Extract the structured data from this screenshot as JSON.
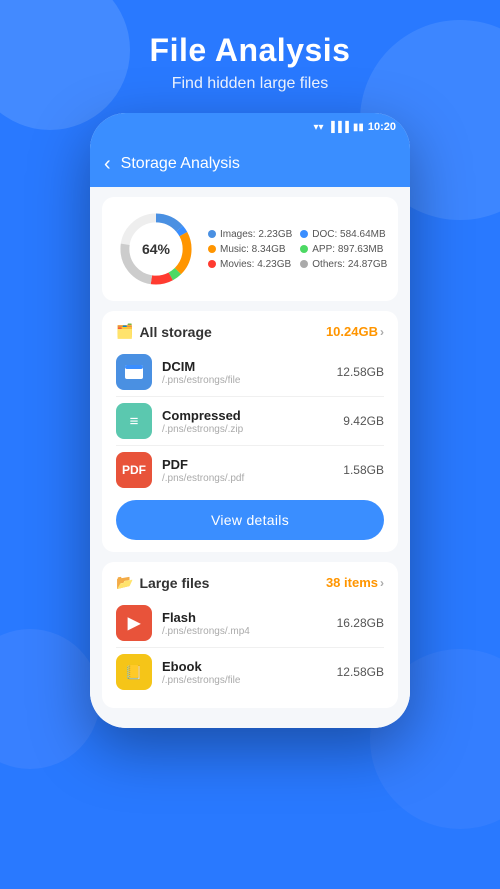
{
  "header": {
    "title": "File Analysis",
    "subtitle": "Find hidden large files"
  },
  "phone": {
    "status_bar": {
      "time": "10:20"
    },
    "app_bar": {
      "title": "Storage Analysis"
    },
    "chart": {
      "percentage": "64%",
      "legend": [
        {
          "label": "Images:",
          "value": "2.23GB",
          "color": "#4a90e2"
        },
        {
          "label": "DOC:",
          "value": "584.64MB",
          "color": "#3a8eff"
        },
        {
          "label": "Music:",
          "value": "8.34GB",
          "color": "#ff9500"
        },
        {
          "label": "APP:",
          "value": "897.63MB",
          "color": "#4cd964"
        },
        {
          "label": "Movies:",
          "value": "4.23GB",
          "color": "#ff3b30"
        },
        {
          "label": "Others:",
          "value": "24.87GB",
          "color": "#aaa"
        }
      ]
    },
    "all_storage": {
      "label": "All storage",
      "icon": "🗂️",
      "total": "10.24GB",
      "files": [
        {
          "name": "DCIM",
          "path": "/.pns/estrongs/file",
          "size": "12.58GB",
          "icon_bg": "#4a90e2",
          "icon_color": "#fff",
          "icon": "📁"
        },
        {
          "name": "Compressed",
          "path": "/.pns/estrongs/.zip",
          "size": "9.42GB",
          "icon_bg": "#4cd964",
          "icon_color": "#fff",
          "icon": "🗜️"
        },
        {
          "name": "PDF",
          "path": "/.pns/estrongs/.pdf",
          "size": "1.58GB",
          "icon_bg": "#ff6b6b",
          "icon_color": "#fff",
          "icon": "📄"
        }
      ],
      "btn_label": "View details"
    },
    "large_files": {
      "label": "Large files",
      "icon": "📂",
      "count": "38 items",
      "files": [
        {
          "name": "Flash",
          "path": "/.pns/estrongs/.mp4",
          "size": "16.28GB",
          "icon_bg": "#ff3b30",
          "icon_color": "#fff",
          "icon": "⚡"
        },
        {
          "name": "Ebook",
          "path": "/.pns/estrongs/file",
          "size": "12.58GB",
          "icon_bg": "#ffcc00",
          "icon_color": "#fff",
          "icon": "📒"
        }
      ]
    }
  }
}
